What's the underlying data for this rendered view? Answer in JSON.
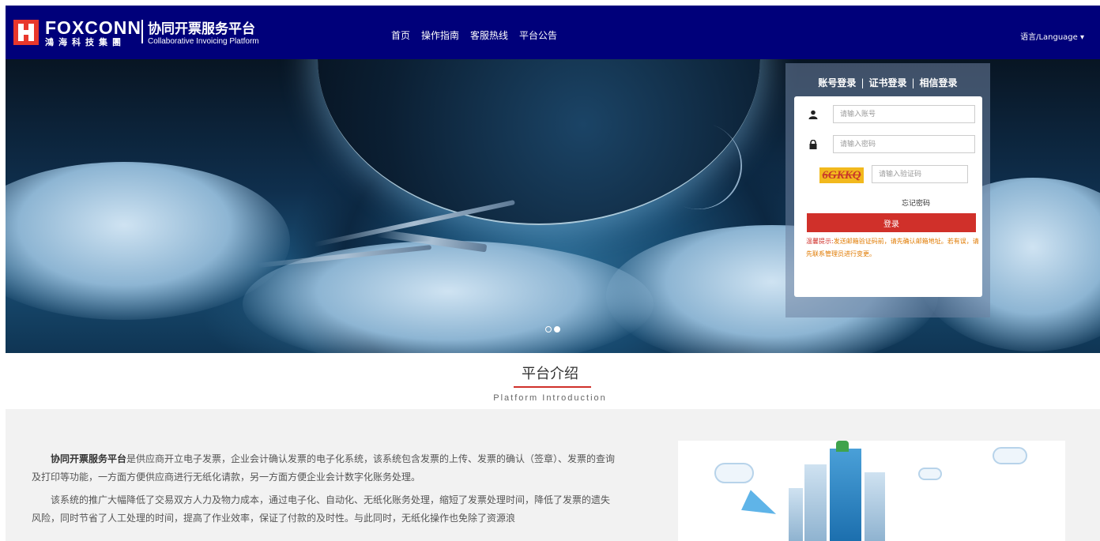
{
  "header": {
    "logo_brand": "FOXCONN",
    "logo_cn": "鴻海科技集團",
    "logo_title": "协同开票服务平台",
    "logo_subtitle": "Collaborative Invoicing Platform",
    "nav": [
      "首页",
      "操作指南",
      "客服热线",
      "平台公告"
    ],
    "language": "语言/Language ▾"
  },
  "banner": {
    "slides": 2,
    "active_slide": 2
  },
  "login": {
    "tabs": [
      "账号登录",
      "证书登录",
      "相信登录"
    ],
    "tab_separator": "|",
    "account_placeholder": "请输入账号",
    "password_placeholder": "请输入密码",
    "captcha_text": "6GKKQ",
    "captcha_placeholder": "请输入验证码",
    "forgot_password": "忘记密码",
    "login_button": "登录",
    "notice_label": "温馨提示:",
    "notice_text": "发送邮箱验证码前，请先确认邮箱地址。若有误，请先联系管理员进行变更。"
  },
  "intro": {
    "title": "平台介绍",
    "subtitle": "Platform Introduction",
    "para1_bold": "协同开票服务平台",
    "para1_rest": "是供应商开立电子发票，企业会计确认发票的电子化系统，该系统包含发票的上传、发票的确认（签章）、发票的查询及打印等功能，一方面方便供应商进行无纸化请款，另一方面方便企业会计数字化账务处理。",
    "para2": "该系统的推广大幅降低了交易双方人力及物力成本，通过电子化、自动化、无纸化账务处理，缩短了发票处理时间，降低了发票的遗失风险，同时节省了人工处理的时间，提高了作业效率，保证了付款的及时性。与此同时，无纸化操作也免除了资源浪"
  },
  "colors": {
    "header_bg": "#00007a",
    "accent_red": "#d0302a",
    "notice_orange": "#e07a00"
  }
}
